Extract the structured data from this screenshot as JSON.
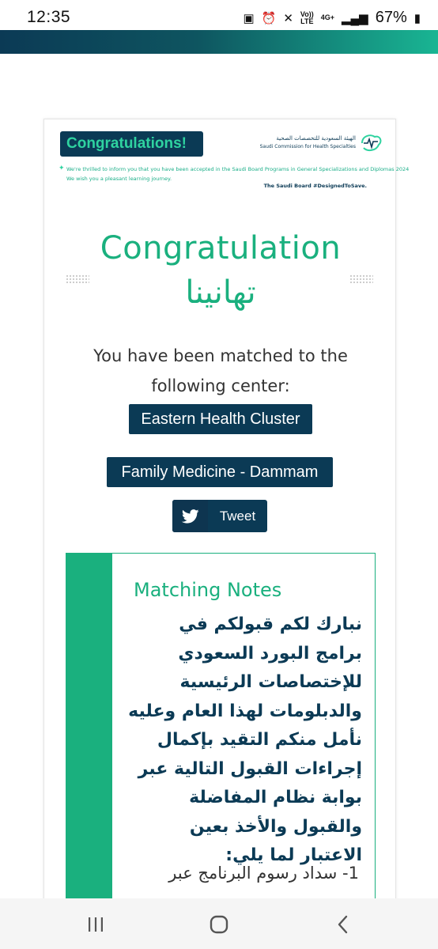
{
  "status_bar": {
    "time": "12:35",
    "network": "4G+",
    "volte_top": "Vo))",
    "volte_bottom": "LTE",
    "battery": "67%"
  },
  "banner": {
    "title": "Congratulations!",
    "org_ar": "الهيئة السعودية للتخصصات الصحية",
    "org_en": "Saudi Commission for Health Specialties",
    "message_line1": "We're thrilled to inform you that you have been accepted in the Saudi Board Programs in General Specializations and Diplomas 2024",
    "message_line2": "We wish you a pleasant learning journey.",
    "tagline": "The Saudi Board #DesignedToSave."
  },
  "main": {
    "title_en": "Congratulation",
    "title_ar": "تهانينا",
    "matched_text": "You have been matched to the following center:",
    "center": "Eastern Health Cluster",
    "program": "Family Medicine - Dammam",
    "tweet_label": "Tweet"
  },
  "notes": {
    "title": "Matching Notes",
    "body": "نبارك لكم قبولكم في برامج البورد السعودي للإختصاصات الرئيسية والدبلومات لهذا العام وعليه نأمل منكم التقيد بإكمال إجراءات القبول التالية عبر بوابة نظام المفاضلة والقبول والأخذ بعين الاعتبار لما يلي:",
    "item1": "1- سداد رسوم البرنامج عبر"
  },
  "colors": {
    "navy": "#0b3a55",
    "green": "#1ab07e",
    "accent": "#2fd3a0"
  },
  "icons": [
    "twitter-bird-icon",
    "recents-icon",
    "home-icon",
    "back-icon"
  ]
}
